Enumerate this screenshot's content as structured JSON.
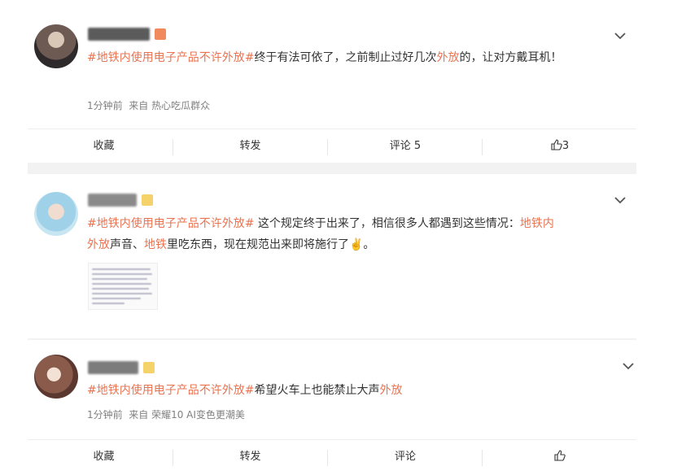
{
  "posts": [
    {
      "meta_time": "1分钟前",
      "meta_source": "来自 热心吃瓜群众",
      "text_lines": [
        [
          {
            "text": "#地铁内使用电子产品不许外放#",
            "hl": true
          },
          {
            "text": "终于有法可依了，之前制止过好几次",
            "hl": false
          },
          {
            "text": "外放",
            "hl": true
          },
          {
            "text": "的，让对方戴耳机！",
            "hl": false
          }
        ]
      ],
      "actions": {
        "collect": "收藏",
        "repost": "转发",
        "comment": "评论 5",
        "like": "3"
      }
    },
    {
      "text_lines": [
        [
          {
            "text": "#地铁内使用电子产品不许外放#",
            "hl": true
          },
          {
            "text": " 这个规定终于出来了，相信很多人都遇到这些情况：",
            "hl": false
          },
          {
            "text": "地铁内",
            "hl": true
          }
        ],
        [
          {
            "text": "外放",
            "hl": true
          },
          {
            "text": "声音、",
            "hl": false
          },
          {
            "text": "地铁",
            "hl": true
          },
          {
            "text": "里吃东西，现在规范出来即将施行了✌️。",
            "hl": false
          }
        ]
      ]
    },
    {
      "meta_time": "1分钟前",
      "meta_source": "来自 荣耀10 AI变色更潮美",
      "text_lines": [
        [
          {
            "text": "#地铁内使用电子产品不许外放#",
            "hl": true
          },
          {
            "text": "希望火车上也能禁止大声",
            "hl": false
          },
          {
            "text": "外放",
            "hl": true
          }
        ]
      ],
      "actions": {
        "collect": "收藏",
        "repost": "转发",
        "comment": "评论",
        "like": ""
      }
    }
  ],
  "icons": {
    "expand": "chevron-down-icon",
    "like": "thumbs-up-icon"
  },
  "colors": {
    "highlight": "#eb7350",
    "text": "#333333",
    "meta": "#808080"
  }
}
